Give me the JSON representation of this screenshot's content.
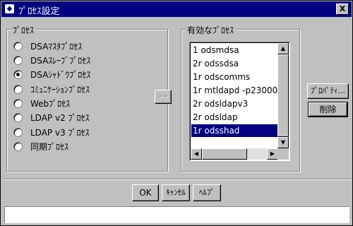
{
  "window": {
    "title": "ﾌﾟﾛｾｽ設定",
    "close_label": "X"
  },
  "process_group": {
    "label": "ﾌﾟﾛｾｽ",
    "options": [
      {
        "label": "DSAﾏｽﾀﾌﾟﾛｾｽ",
        "selected": false
      },
      {
        "label": "DSAｽﾚｰﾌﾞﾌﾟﾛｾｽ",
        "selected": false
      },
      {
        "label": "DSAｼｬﾄﾞｳﾌﾟﾛｾｽ",
        "selected": true
      },
      {
        "label": "ｺﾐｭﾆｹｰｼｮﾝﾌﾟﾛｾｽ",
        "selected": false
      },
      {
        "label": "Webﾌﾟﾛｾｽ",
        "selected": false
      },
      {
        "label": "LDAP v2 ﾌﾟﾛｾｽ",
        "selected": false
      },
      {
        "label": "LDAP v3 ﾌﾟﾛｾｽ",
        "selected": false
      },
      {
        "label": "同期ﾌﾟﾛｾｽ",
        "selected": false
      }
    ]
  },
  "move_button": {
    "label": ">>",
    "enabled": false
  },
  "active_group": {
    "label": "有効なﾌﾟﾛｾｽ",
    "items": [
      "1 odsmdsa",
      "2r odssdsa",
      "1r odscomms",
      "1r mtldapd -p23000",
      "2r odsldapv3",
      "2r odsldap",
      "1r odsshad"
    ],
    "selected_index": 6
  },
  "side_buttons": {
    "properties": "ﾌﾟﾛﾊﾟﾃｨ...",
    "delete": "削除"
  },
  "footer_buttons": {
    "ok": "OK",
    "cancel": "ｷｬﾝｾﾙ",
    "help": "ﾍﾙﾌﾟ"
  },
  "status_text": ""
}
